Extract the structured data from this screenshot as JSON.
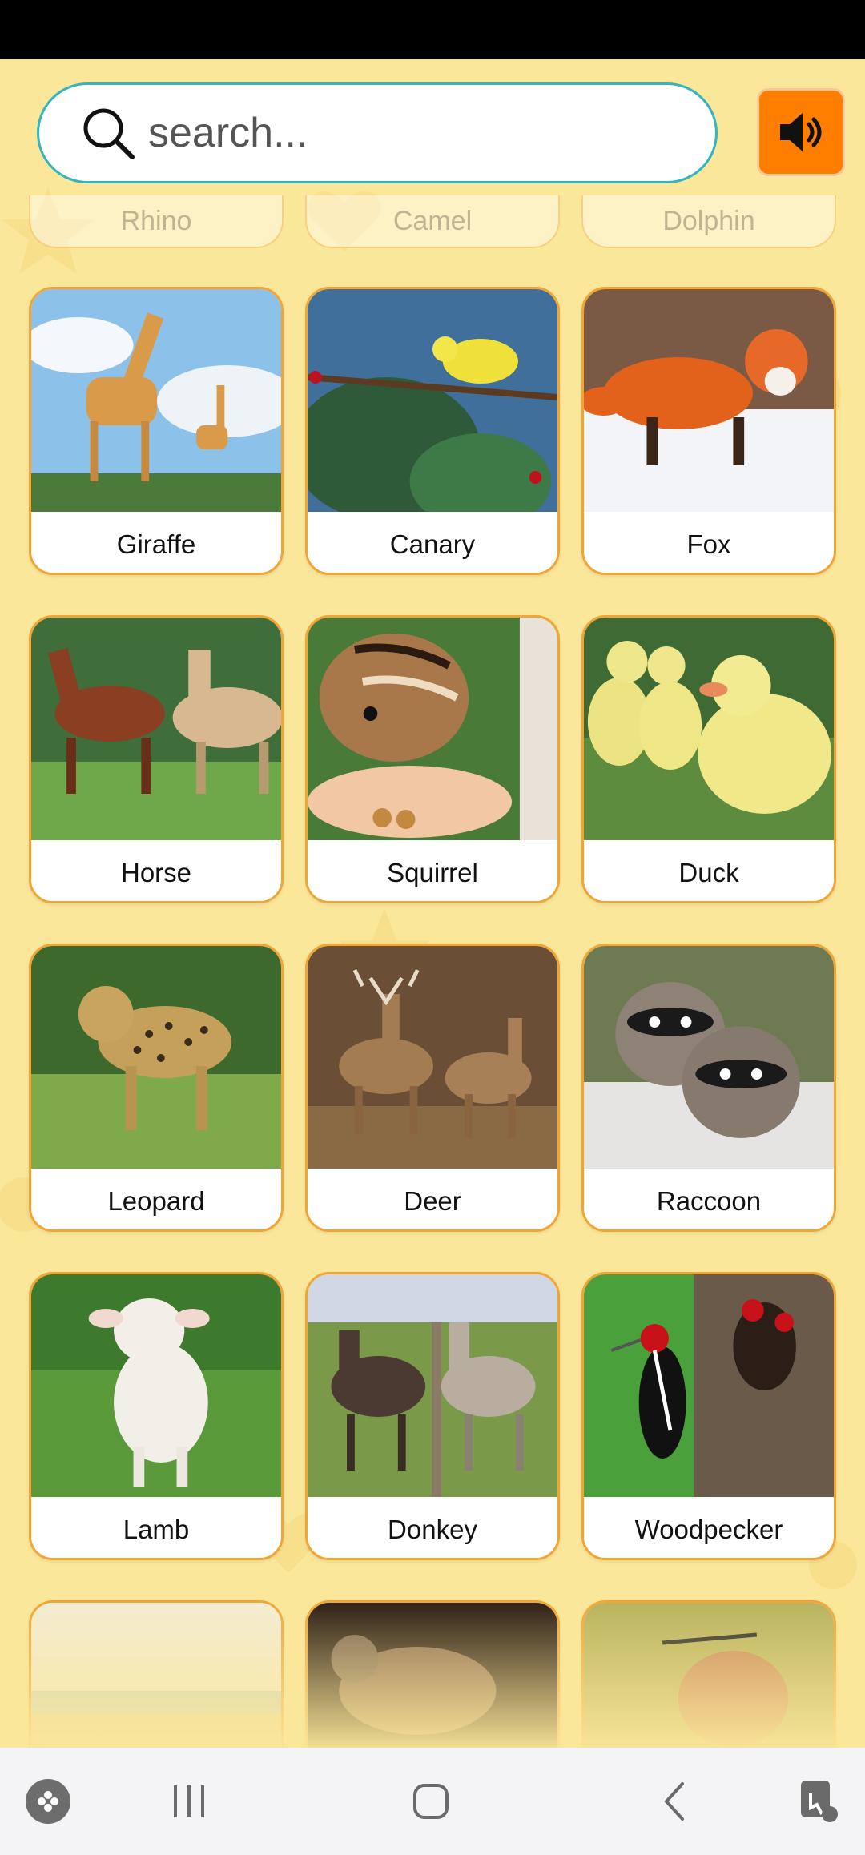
{
  "search": {
    "placeholder": "search..."
  },
  "sound_button": {
    "icon": "speaker-icon",
    "color": "#ff7e00"
  },
  "partial_top_row": [
    "Rhino",
    "Camel",
    "Dolphin"
  ],
  "animals": [
    {
      "name": "Giraffe"
    },
    {
      "name": "Canary"
    },
    {
      "name": "Fox"
    },
    {
      "name": "Horse"
    },
    {
      "name": "Squirrel"
    },
    {
      "name": "Duck"
    },
    {
      "name": "Leopard"
    },
    {
      "name": "Deer"
    },
    {
      "name": "Raccoon"
    },
    {
      "name": "Lamb"
    },
    {
      "name": "Donkey"
    },
    {
      "name": "Woodpecker"
    }
  ],
  "nav_bar": {
    "items": [
      "game-launcher-icon",
      "recent-apps-icon",
      "home-icon",
      "back-icon",
      "screen-touch-icon"
    ]
  }
}
